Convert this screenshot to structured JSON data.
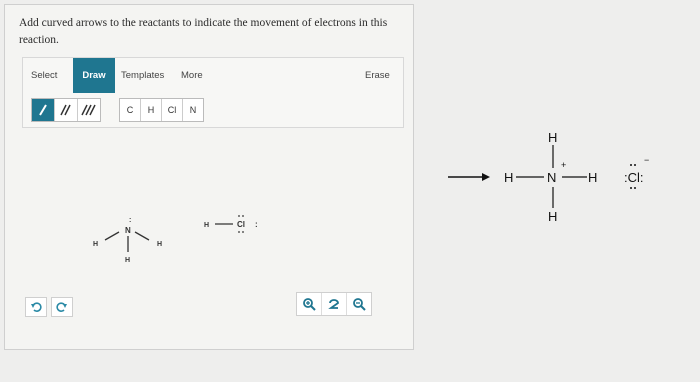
{
  "question": {
    "text": "Add curved arrows to the reactants to indicate the movement of electrons in this reaction."
  },
  "toolbar": {
    "select_label": "Select",
    "draw_label": "Draw",
    "templates_label": "Templates",
    "more_label": "More",
    "erase_label": "Erase",
    "active_tab": "Draw",
    "active_color": "#1f7690"
  },
  "bond_tools": [
    {
      "icon": "single-bond-icon",
      "glyph": "/"
    },
    {
      "icon": "double-bond-icon",
      "glyph": "//"
    },
    {
      "icon": "triple-bond-icon",
      "glyph": "///"
    }
  ],
  "atom_tools": [
    "C",
    "H",
    "Cl",
    "N"
  ],
  "reactants": {
    "ammonia": {
      "center": "N",
      "h_left": "H",
      "h_right": "H",
      "h_bottom": "H",
      "lone_pair": ":"
    },
    "hcl": {
      "h": "H",
      "cl": "Cl",
      "lone_pair": ":"
    }
  },
  "product": {
    "ammonium": {
      "n": "N",
      "charge": "+",
      "h_top": "H",
      "h_left": "H",
      "h_right": "H",
      "h_bottom": "H"
    },
    "chloride": {
      "cl": ":Cl:",
      "charge": "−"
    }
  },
  "controls": {
    "undo_icon": "undo-icon",
    "redo_icon": "redo-icon",
    "zoom_in_icon": "zoom-in-icon",
    "reset_icon": "reset-zoom-icon",
    "zoom_out_icon": "zoom-out-icon"
  }
}
